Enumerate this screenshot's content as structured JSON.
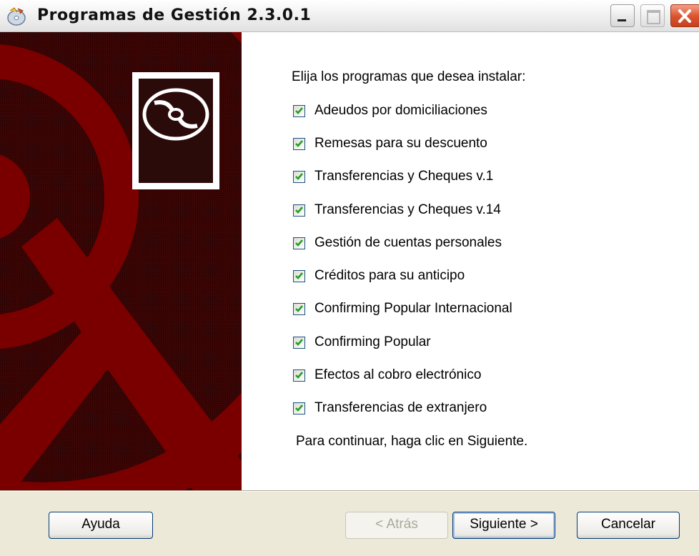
{
  "window": {
    "title": "Programas de Gestión 2.3.0.1",
    "controls": [
      "minimize",
      "maximize",
      "close"
    ]
  },
  "main": {
    "prompt": "Elija los programas que desea instalar:",
    "programs": [
      {
        "label": "Adeudos por domiciliaciones",
        "checked": true
      },
      {
        "label": "Remesas para su descuento",
        "checked": true
      },
      {
        "label": "Transferencias y Cheques v.1",
        "checked": true
      },
      {
        "label": "Transferencias y Cheques v.14",
        "checked": true
      },
      {
        "label": "Gestión de cuentas personales",
        "checked": true
      },
      {
        "label": "Créditos para su anticipo",
        "checked": true
      },
      {
        "label": "Confirming Popular Internacional",
        "checked": true
      },
      {
        "label": "Confirming Popular",
        "checked": true
      },
      {
        "label": "Efectos al cobro electrónico",
        "checked": true
      },
      {
        "label": "Transferencias de extranjero",
        "checked": true
      }
    ],
    "footer_note": "Para continuar, haga clic en Siguiente."
  },
  "buttons": {
    "help": "Ayuda",
    "back": "< Atrás",
    "next": "Siguiente >",
    "cancel": "Cancelar"
  },
  "colors": {
    "banner_red": "#7a0000",
    "checkmark": "#21a121",
    "checkbox_border": "#1c5180"
  },
  "icons": {
    "app": "installer-cd-icon",
    "banner": "cd-disc-icon"
  }
}
